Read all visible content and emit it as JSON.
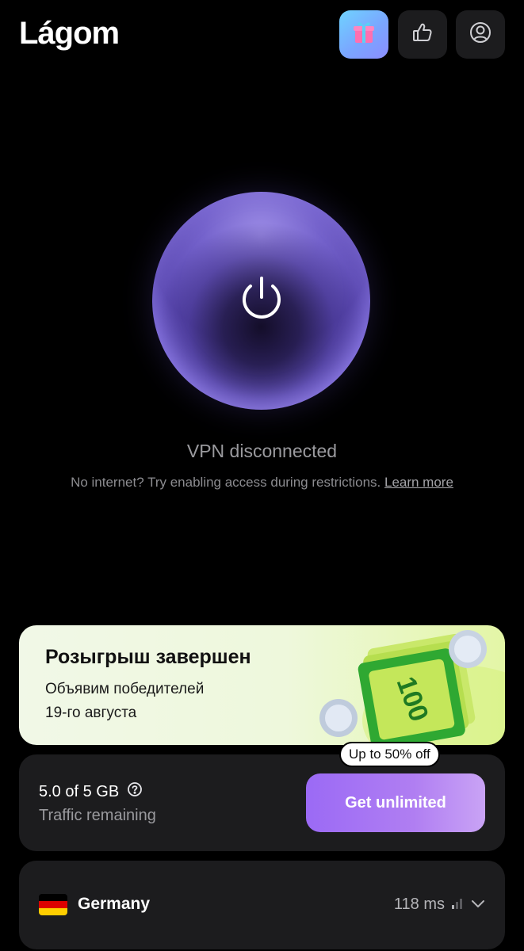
{
  "header": {
    "logo": "Lágom",
    "buttons": [
      {
        "name": "gift",
        "icon": "gift-icon"
      },
      {
        "name": "rate",
        "icon": "thumbs-up-icon"
      },
      {
        "name": "account",
        "icon": "user-icon"
      }
    ]
  },
  "vpn": {
    "power_icon": "power-icon",
    "status": "VPN disconnected",
    "hint_text": "No internet? Try enabling access during restrictions. ",
    "hint_link": "Learn more"
  },
  "promo": {
    "title": "Розыгрыш завершен",
    "line1": "Объявим победителей",
    "line2": "19-го августа",
    "art_text": "100",
    "accent_color": "#2fa832"
  },
  "traffic": {
    "amount": "5.0 of 5 GB",
    "label": "Traffic remaining",
    "help_icon": "question-circle-icon",
    "cta_label": "Get unlimited",
    "badge": "Up to 50% off",
    "cta_color": "#a073f3"
  },
  "location": {
    "country": "Germany",
    "flag_colors": [
      "#000000",
      "#dd0000",
      "#ffce00"
    ],
    "ping": "118 ms",
    "signal_icon": "signal-bars-icon",
    "chevron_icon": "chevron-down-icon"
  }
}
